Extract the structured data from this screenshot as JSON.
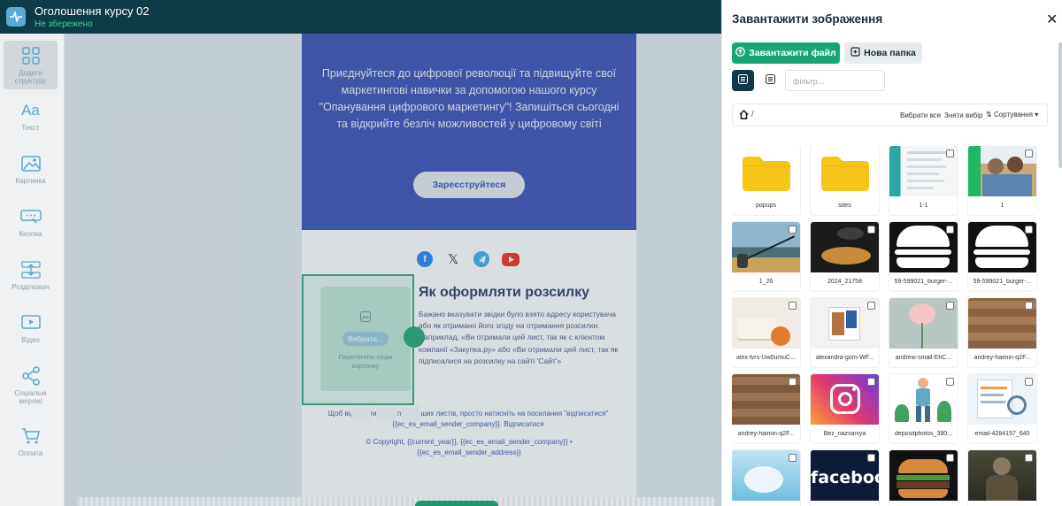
{
  "header": {
    "title": "Оголошення курсу 02",
    "status": "Не збережено"
  },
  "sidebar": {
    "items": [
      {
        "label": "Додати структуру",
        "icon": "grid-icon"
      },
      {
        "label": "Текст",
        "icon": "text-icon"
      },
      {
        "label": "Картинка",
        "icon": "image-icon"
      },
      {
        "label": "Кнопка",
        "icon": "button-icon"
      },
      {
        "label": "Розділювач",
        "icon": "divider-icon"
      },
      {
        "label": "Відео",
        "icon": "video-icon"
      },
      {
        "label": "Соціальні мережі",
        "icon": "share-icon"
      },
      {
        "label": "Оплата",
        "icon": "cart-icon"
      }
    ]
  },
  "email": {
    "hero_text": "Приєднуйтеся до цифрової революції та підвищуйте свої маркетингові навички за допомогою нашого курсу \"Опанування цифрового маркетингу\"! Запишіться сьогодні та відкрийте безліч можливостей у цифровому світі",
    "cta_label": "Зареєструйтеся",
    "socials": [
      "facebook-icon",
      "x-icon",
      "telegram-icon",
      "youtube-icon"
    ],
    "article_title": "Як оформляти розсилку",
    "article_body": "Бажано вказувати звідки було взято адресу користувача або як отримано його згоду на отримання розсилки. Наприклад, «Ви отримали цей лист, так як с клієнтом компанії «Закупка.ру» або «Ви отримали цей лист, так як підписалися на розсилку на сайті 'Сайт'»",
    "image_block": {
      "pick_label": "Вибрати...",
      "hint": "Перетягніть сюди картинку"
    },
    "footer_unsub": "Щоб відписатися від подальших листів, просто натисніть на посилання \"відписатися\"",
    "footer_unsub_line2": "{{ec_es_email_sender_company}}. Відписатися",
    "footer_copyright": "© Copyright, {{current_year}}, {{ec_es_email_sender_company}} •",
    "footer_address": "{{ec_es_email_sender_address}}"
  },
  "panel": {
    "title": "Завантажити зображення",
    "upload_label": "Завантажити файл",
    "new_folder_label": "Нова папка",
    "filter_placeholder": "фільтр...",
    "path": "/",
    "select_all": "Вибрати все",
    "clear_selection": "Зняти вибір",
    "sort_label": "Сортування",
    "items": [
      {
        "name": "popups",
        "type": "folder"
      },
      {
        "name": "sites",
        "type": "folder"
      },
      {
        "name": "1-1",
        "type": "image"
      },
      {
        "name": "1",
        "type": "image"
      },
      {
        "name": "1_26",
        "type": "image"
      },
      {
        "name": "2024_21758",
        "type": "image"
      },
      {
        "name": "59-599021_burger-...",
        "type": "image"
      },
      {
        "name": "59-599021_burger-...",
        "type": "image"
      },
      {
        "name": "alex-lvrs-Uw0umuC...",
        "type": "image"
      },
      {
        "name": "alexandra-gorn-WF...",
        "type": "image"
      },
      {
        "name": "andrew-small-EhC...",
        "type": "image"
      },
      {
        "name": "andrey-haimin-q2F...",
        "type": "image"
      },
      {
        "name": "andrey-haimin-q2F...",
        "type": "image"
      },
      {
        "name": "Bez_nazvaniya",
        "type": "image"
      },
      {
        "name": "depositphotos_390...",
        "type": "image"
      },
      {
        "name": "email-4284157_640",
        "type": "image"
      },
      {
        "name": "",
        "type": "image"
      },
      {
        "name": "",
        "type": "image",
        "overlay_text": "faceboo"
      },
      {
        "name": "",
        "type": "image"
      },
      {
        "name": "",
        "type": "image"
      }
    ]
  },
  "colors": {
    "brand_dark": "#0d3b4a",
    "accent": "#17a673",
    "hero_blue": "#2b43ac"
  }
}
